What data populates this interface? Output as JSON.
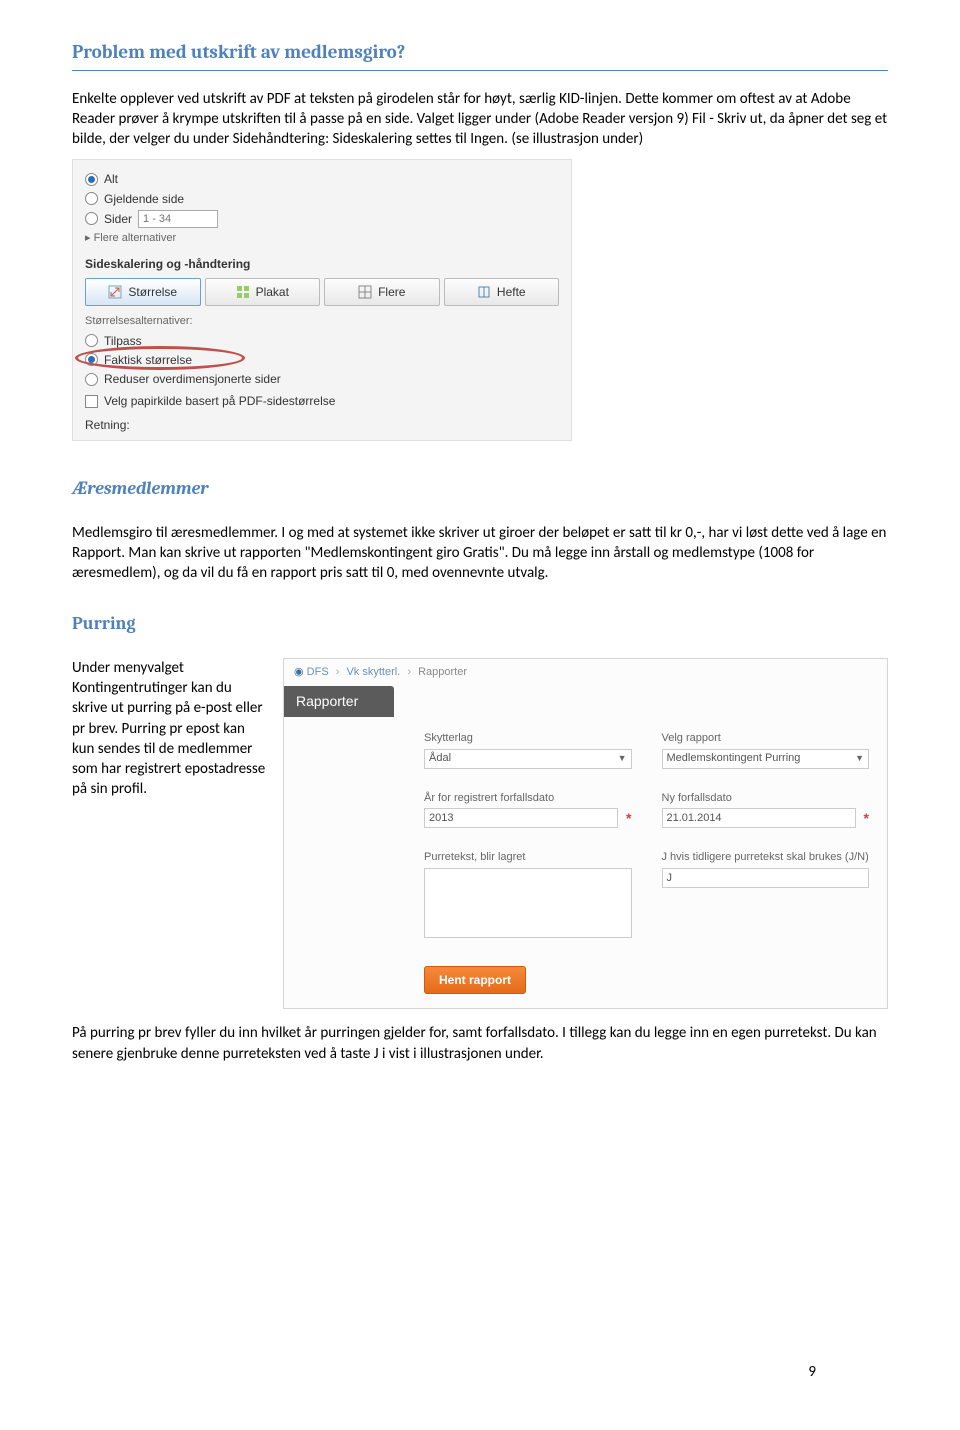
{
  "sections": {
    "problem": {
      "heading": "Problem med utskrift av medlemsgiro?",
      "para": "Enkelte opplever ved utskrift av PDF at teksten på girodelen står for høyt, særlig KID-linjen. Dette kommer om oftest av at Adobe Reader prøver å krympe utskriften til å passe på en side. Valget ligger under (Adobe Reader versjon 9) Fil - Skriv ut, da åpner det seg et bilde, der velger du under Sidehåndtering: Sideskalering settes til Ingen. (se illustrasjon under)"
    },
    "aeres": {
      "heading": "Æresmedlemmer",
      "para": "Medlemsgiro til æresmedlemmer. I og med at systemet ikke skriver ut giroer der beløpet er satt til kr 0,-, har vi løst dette ved å lage en Rapport. Man kan skrive ut rapporten \"Medlemskontingent giro Gratis\". Du må legge inn årstall og medlemstype (1008 for æresmedlem), og da vil du få en rapport pris satt til 0, med ovennevnte utvalg."
    },
    "purring": {
      "heading": "Purring",
      "aside": "Under menyvalget Kontingentrutinger kan du skrive ut purring på e-post eller pr brev. Purring pr epost kan kun sendes til de medlemmer som har registrert epostadresse på sin profil.",
      "below": "På purring pr brev fyller du inn hvilket år purringen gjelder for, samt forfallsdato. I tillegg kan du legge inn en egen purretekst. Du kan senere gjenbruke denne purreteksten ved å taste J i vist i illustrasjonen under."
    }
  },
  "adobe": {
    "radio_alt": "Alt",
    "radio_gjeldende": "Gjeldende side",
    "radio_sider": "Sider",
    "pages_placeholder": "1 - 34",
    "more_options": "Flere alternativer",
    "scaling_heading": "Sideskalering og -håndtering",
    "tabs": {
      "size": "Størrelse",
      "poster": "Plakat",
      "multiple": "Flere",
      "booklet": "Hefte"
    },
    "size_alt_label": "Størrelsesalternativer:",
    "opt_tilpass": "Tilpass",
    "opt_faktisk": "Faktisk størrelse",
    "opt_reduser": "Reduser overdimensjonerte sider",
    "opt_papirkilde": "Velg papirkilde basert på PDF-sidestørrelse",
    "retning": "Retning:"
  },
  "rapporter": {
    "breadcrumb": {
      "root": "DFS",
      "mid": "Vk skytterl.",
      "leaf": "Rapporter"
    },
    "title": "Rapporter",
    "labels": {
      "skytterlag": "Skytterlag",
      "velg_rapport": "Velg rapport",
      "aar": "År for registrert forfallsdato",
      "ny_forfall": "Ny forfallsdato",
      "purretekst": "Purretekst, blir lagret",
      "j_hvis": "J hvis tidligere purretekst skal brukes (J/N)"
    },
    "values": {
      "skytterlag": "Ådal",
      "velg_rapport": "Medlemskontingent Purring",
      "aar": "2013",
      "ny_forfall": "21.01.2014",
      "j": "J"
    },
    "button": "Hent rapport"
  },
  "page_number": "9"
}
